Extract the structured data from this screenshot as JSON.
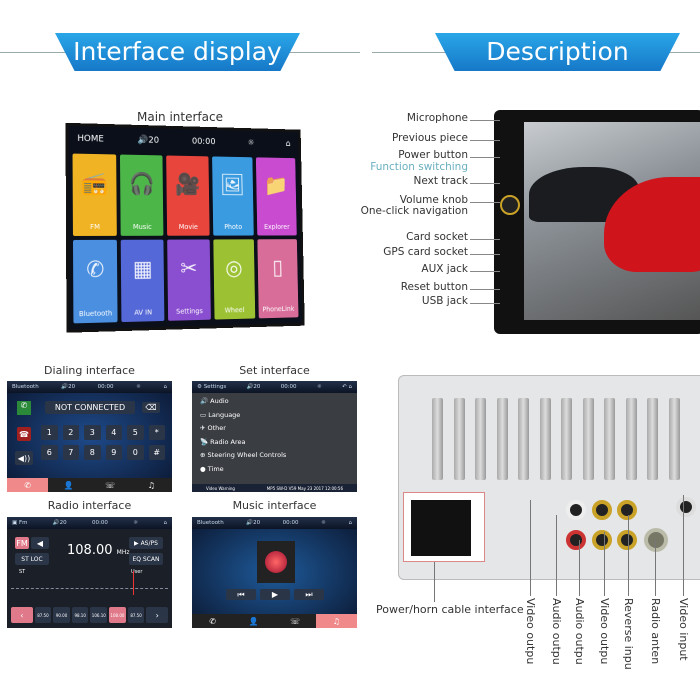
{
  "headers": {
    "left": "Interface display",
    "right": "Description"
  },
  "main": {
    "caption": "Main interface",
    "home": "HOME",
    "volume": "20",
    "time": "00:00",
    "tiles": [
      {
        "label": "FM",
        "color": "#f0b323",
        "icon": "radio-icon"
      },
      {
        "label": "Music",
        "color": "#4cb748",
        "icon": "headphones-icon"
      },
      {
        "label": "Movie",
        "color": "#e8453c",
        "icon": "camera-icon"
      },
      {
        "label": "Photo",
        "color": "#3b9be0",
        "icon": "photo-icon"
      },
      {
        "label": "Explorer",
        "color": "#c84bd0",
        "icon": "folder-icon"
      },
      {
        "label": "Bluetooth",
        "color": "#4a8fe0",
        "icon": "phone-icon"
      },
      {
        "label": "AV IN",
        "color": "#5568d8",
        "icon": "av-icon"
      },
      {
        "label": "Settings",
        "color": "#8a4fd0",
        "icon": "tools-icon"
      },
      {
        "label": "Wheel",
        "color": "#9cc234",
        "icon": "steering-wheel-icon"
      },
      {
        "label": "PhoneLink",
        "color": "#d86d9a",
        "icon": "phonelink-icon"
      }
    ]
  },
  "dialing": {
    "caption": "Dialing interface",
    "title": "Bluetooth",
    "volume": "20",
    "time": "00:00",
    "status": "NOT CONNECTED",
    "keys": [
      "1",
      "2",
      "3",
      "4",
      "5",
      "*",
      "6",
      "7",
      "8",
      "9",
      "0",
      "#"
    ]
  },
  "settings": {
    "caption": "Set interface",
    "title": "Settings",
    "volume": "20",
    "time": "00:00",
    "items": [
      "Audio",
      "Language",
      "Other",
      "Radio Area",
      "Steering Wheel Controls",
      "Time"
    ],
    "footer_left": "Video Warning",
    "footer_right": "MP5 SW-D V59 May 23 2017 12:00:56"
  },
  "radio": {
    "caption": "Radio interface",
    "title": "Fm",
    "volume": "20",
    "time": "00:00",
    "frequency": "108.00",
    "unit": "MHz",
    "buttons": [
      "ST",
      "LOC",
      "AS/PS",
      "EQ",
      "SCAN"
    ],
    "st": "ST",
    "user": "User",
    "presets": [
      "87.50",
      "90.00",
      "98.10",
      "106.10",
      "108.00",
      "87.50"
    ]
  },
  "music": {
    "caption": "Music interface",
    "title": "Bluetooth",
    "volume": "20",
    "time": "00:00"
  },
  "front_labels": [
    "Microphone",
    "Previous piece",
    "Power button",
    "Function switching",
    "Next track",
    "Volume knob",
    "One-click navigation",
    "Card socket",
    "GPS card socket",
    "AUX jack",
    "Reset button",
    "USB jack"
  ],
  "back": {
    "power_label": "Power/horn cable interface",
    "ports": [
      "Video outpu",
      "Audio outpu",
      "Audio outpu",
      "Video outpu",
      "Reverse inpu",
      "Radio anten",
      "Video input"
    ]
  }
}
